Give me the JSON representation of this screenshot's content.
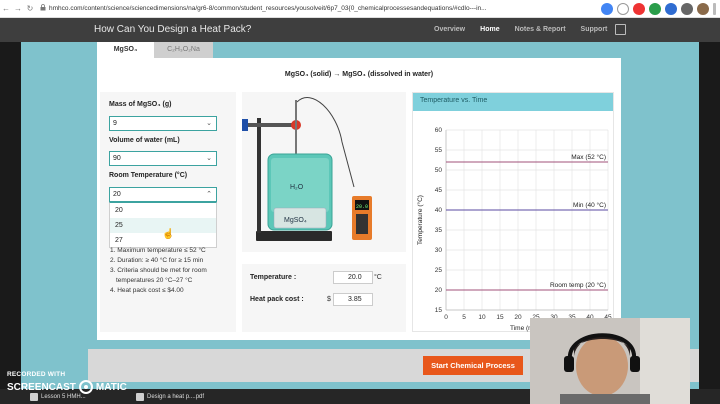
{
  "browser": {
    "url": "hmhco.com/content/science/sciencedimensions/na/gr6-8/common/student_resources/yousolveit/6p7_03{0_chemicalprocessesandequations/#cdlo---in...",
    "nav_back": "←",
    "nav_forward": "→",
    "nav_reload": "↻",
    "lock": "🔒"
  },
  "app": {
    "title": "How Can You Design a Heat Pack?",
    "nav": [
      "Overview",
      "Home",
      "Notes & Report",
      "Support"
    ],
    "active_nav": "Home"
  },
  "tabs": {
    "tab1": "MgSO₄",
    "tab2": "C₂H₃O₂Na"
  },
  "equation": "MgSO₄ (solid) → MgSO₄ (dissolved in water)",
  "inputs": {
    "mass_label": "Mass of MgSO₄ (g)",
    "mass_value": "9",
    "water_label": "Volume of water (mL)",
    "water_value": "90",
    "room_label": "Room Temperature (°C)",
    "room_value": "20",
    "chevron": "⌄"
  },
  "dropdown_options": [
    "20",
    "25",
    "27"
  ],
  "criteria": [
    "1. Maximum temperature ≤ 52 °C",
    "2. Duration: ≥ 40 °C for ≥ 15 min",
    "3. Criteria should be met for room",
    "    temperatures 20 °C–27 °C",
    "4. Heat pack cost ≤ $4.00"
  ],
  "scene": {
    "water_label": "H₂O",
    "salt_label": "MgSO₄",
    "thermo_reading": "20.0"
  },
  "outputs": {
    "temp_label": "Temperature :",
    "temp_value": "20.0",
    "temp_unit": "°C",
    "cost_label": "Heat pack cost :",
    "cost_currency": "$",
    "cost_value": "3.85"
  },
  "chart_title": "Temperature vs. Time",
  "chart_data": {
    "type": "line",
    "ylabel": "Temperature (°C)",
    "xlabel": "Time (mi",
    "ylim": [
      15,
      60
    ],
    "xlim": [
      0,
      45
    ],
    "yticks": [
      15,
      20,
      25,
      30,
      35,
      40,
      45,
      50,
      55,
      60
    ],
    "xticks": [
      0,
      5,
      10,
      15,
      20,
      25,
      30,
      35,
      40,
      45
    ],
    "reference_lines": [
      {
        "name": "Max (52 °C)",
        "value": 52,
        "color": "#a0507a"
      },
      {
        "name": "Min (40 °C)",
        "value": 40,
        "color": "#5a4aa0"
      },
      {
        "name": "Room temp (20 °C)",
        "value": 20,
        "color": "#a0507a"
      }
    ],
    "grid": true
  },
  "buttons": {
    "start": "Start Chemical Process"
  },
  "watermark": {
    "recorded": "RECORDED WITH",
    "brand_left": "SCREENCAST",
    "brand_right": "MATIC"
  },
  "taskbar": {
    "item1": "Lesson 5 HMH...",
    "item2": "Design a heat p....pdf"
  },
  "colors": {
    "accent": "#e8571b",
    "teal": "#7fc2cc",
    "chart_header": "#7fd0dc"
  }
}
